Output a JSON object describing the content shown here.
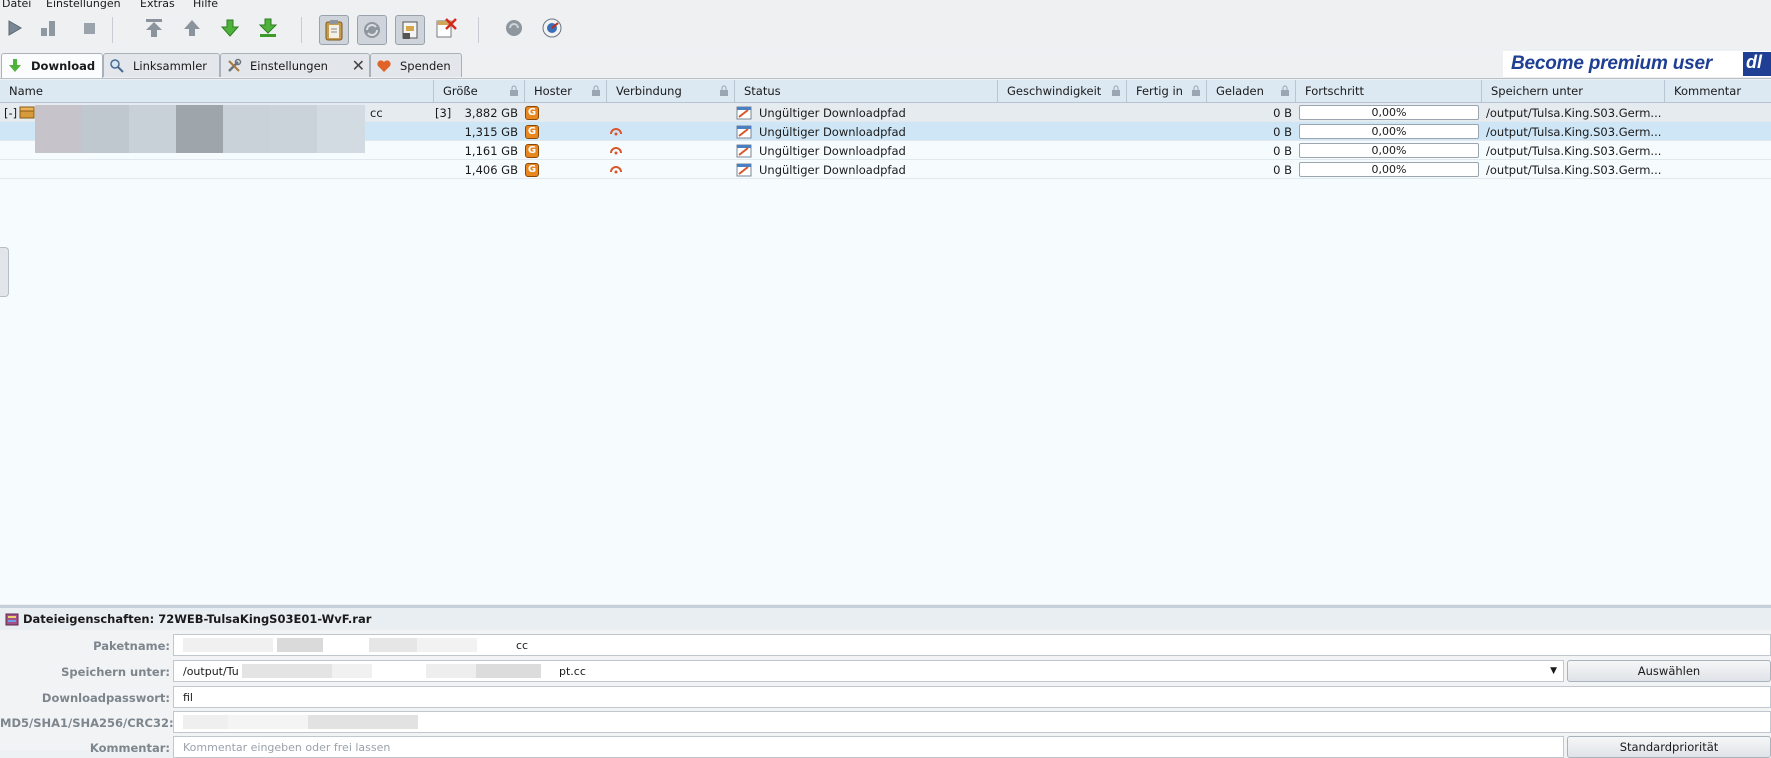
{
  "menu": {
    "file": "Datei",
    "settings": "Einstellungen",
    "extras": "Extras",
    "help": "Hilfe"
  },
  "tabs": [
    {
      "label": "Download"
    },
    {
      "label": "Linksammler"
    },
    {
      "label": "Einstellungen"
    },
    {
      "label": "Spenden"
    }
  ],
  "banner": {
    "text": "Become premium user",
    "logo": "dl"
  },
  "columns": [
    "Name",
    "Größe",
    "Hoster",
    "Verbindung",
    "Status",
    "Geschwindigkeit",
    "Fertig in",
    "Geladen",
    "Fortschritt",
    "Speichern unter",
    "Kommentar"
  ],
  "package": {
    "toggle": "[-]",
    "name_suffix": "cc",
    "count": "[3]",
    "size": "3,882 GB",
    "status": "Ungültiger Downloadpfad",
    "loaded": "0 B",
    "progress": "0,00%",
    "save_to": "/output/Tulsa.King.S03.Germ..."
  },
  "files": [
    {
      "size": "1,315 GB",
      "status": "Ungültiger Downloadpfad",
      "loaded": "0 B",
      "progress": "0,00%",
      "save_to": "/output/Tulsa.King.S03.Germ..."
    },
    {
      "size": "1,161 GB",
      "status": "Ungültiger Downloadpfad",
      "loaded": "0 B",
      "progress": "0,00%",
      "save_to": "/output/Tulsa.King.S03.Germ..."
    },
    {
      "size": "1,406 GB",
      "status": "Ungültiger Downloadpfad",
      "loaded": "0 B",
      "progress": "0,00%",
      "save_to": "/output/Tulsa.King.S03.Germ..."
    }
  ],
  "properties": {
    "title": "Dateieigenschaften: 72WEB-TulsaKingS03E01-WvF.rar",
    "package_label": "Paketname:",
    "package_value": "cc",
    "save_label": "Speichern unter:",
    "save_value_start": "/output/Tu",
    "save_value_end": "pt.cc",
    "choose_button": "Auswählen",
    "password_label": "Downloadpasswort:",
    "password_value": "fil",
    "hash_label": "MD5/SHA1/SHA256/CRC32:",
    "comment_label": "Kommentar:",
    "comment_placeholder": "Kommentar eingeben oder frei lassen",
    "priority_button": "Standardpriorität"
  },
  "colors": {
    "accent": "#1e3f93",
    "hoster": "#e8861f",
    "selected_row": "#cfe6f7"
  }
}
